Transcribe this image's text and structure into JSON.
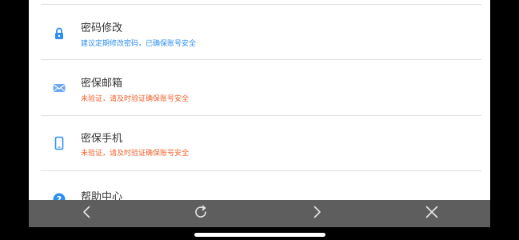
{
  "settings": {
    "items": [
      {
        "icon": "lock-icon",
        "title": "密码修改",
        "subtitle": "建议定期修改密码，已确保账号安全",
        "subtitle_color": "#2f8ff0"
      },
      {
        "icon": "mail-icon",
        "title": "密保邮箱",
        "subtitle": "未验证，请及时验证确保账号安全",
        "subtitle_color": "#f0622e"
      },
      {
        "icon": "phone-icon",
        "title": "密保手机",
        "subtitle": "未验证，请及时验证确保账号安全",
        "subtitle_color": "#f0622e"
      },
      {
        "icon": "help-icon",
        "title": "帮助中心"
      }
    ]
  },
  "colors": {
    "accent_blue": "#2f8ff0",
    "warning_orange": "#f0622e",
    "toolbar_bg": "#5e5e5e"
  },
  "toolbar": {
    "buttons": [
      "back-icon",
      "refresh-icon",
      "forward-icon",
      "close-icon"
    ]
  }
}
